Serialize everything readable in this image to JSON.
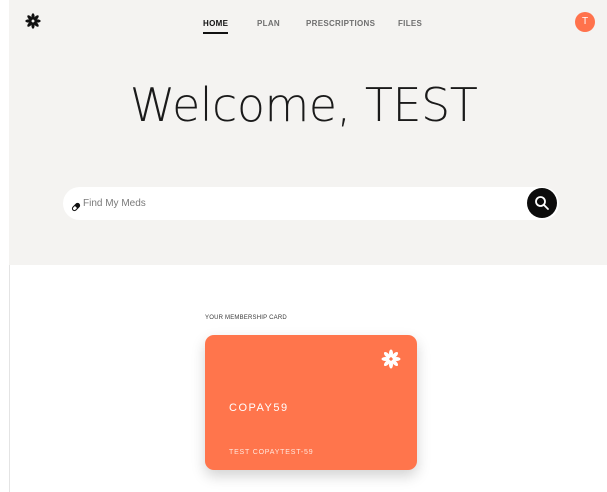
{
  "header": {
    "logo_icon": "asterisk-flower-icon",
    "nav": [
      {
        "label": "HOME",
        "active": true
      },
      {
        "label": "PLAN",
        "active": false
      },
      {
        "label": "PRESCRIPTIONS",
        "active": false
      },
      {
        "label": "FILES",
        "active": false
      }
    ],
    "avatar_initial": "T"
  },
  "hero": {
    "welcome": "Welcome, TEST"
  },
  "search": {
    "placeholder": "Find My Meds",
    "value": "",
    "leading_icon": "pill-icon",
    "button_icon": "search-icon"
  },
  "membership": {
    "label": "YOUR MEMBERSHIP CARD",
    "card_code": "COPAY59",
    "card_name": "TEST COPAYTEST-59",
    "card_logo_icon": "asterisk-flower-icon"
  },
  "colors": {
    "accent": "#ff724c",
    "hero_background": "#f4f3f1",
    "search_button": "#0c0c0c"
  }
}
